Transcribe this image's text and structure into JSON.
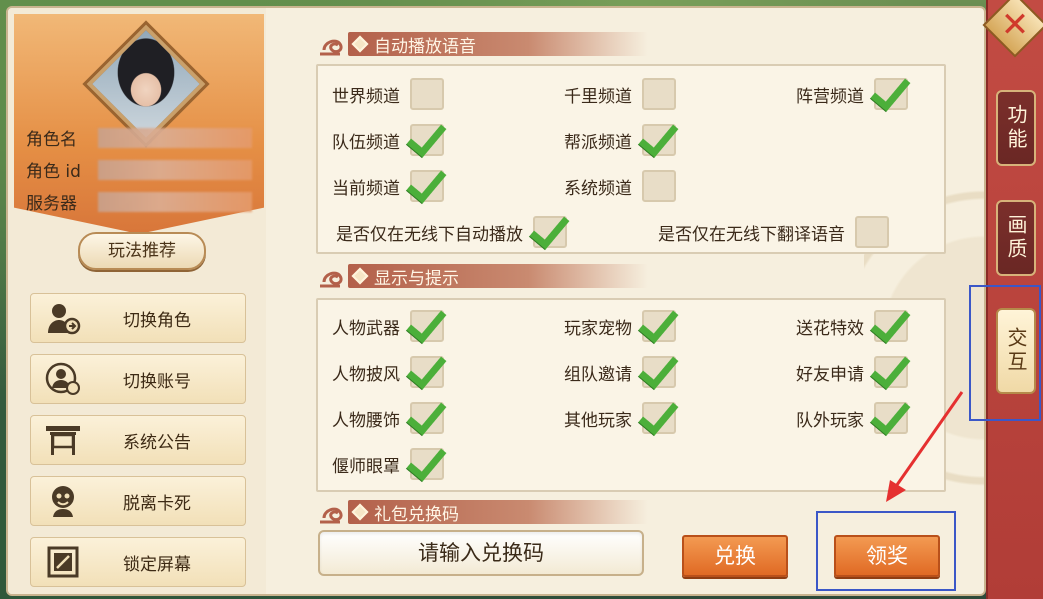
{
  "profile": {
    "name_label": "角色名",
    "id_label": "角色 id",
    "server_label": "服务器",
    "recommend_label": "玩法推荐"
  },
  "left_menu": {
    "items": [
      {
        "label": "切换角色",
        "icon": "switch-character-icon"
      },
      {
        "label": "切换账号",
        "icon": "switch-account-icon"
      },
      {
        "label": "系统公告",
        "icon": "announcement-icon"
      },
      {
        "label": "脱离卡死",
        "icon": "unstuck-icon"
      },
      {
        "label": "锁定屏幕",
        "icon": "lock-screen-icon"
      }
    ]
  },
  "sections": {
    "voice": {
      "title": "自动播放语音",
      "options": [
        {
          "label": "世界频道",
          "checked": false
        },
        {
          "label": "千里频道",
          "checked": false
        },
        {
          "label": "阵营频道",
          "checked": true
        },
        {
          "label": "队伍频道",
          "checked": true
        },
        {
          "label": "帮派频道",
          "checked": true
        },
        {
          "label": "当前频道",
          "checked": true
        },
        {
          "label": "系统频道",
          "checked": false
        },
        {
          "label": "是否仅在无线下自动播放",
          "checked": true
        },
        {
          "label": "是否仅在无线下翻译语音",
          "checked": false
        }
      ]
    },
    "display": {
      "title": "显示与提示",
      "options": [
        {
          "label": "人物武器",
          "checked": true
        },
        {
          "label": "玩家宠物",
          "checked": true
        },
        {
          "label": "送花特效",
          "checked": true
        },
        {
          "label": "人物披风",
          "checked": true
        },
        {
          "label": "组队邀请",
          "checked": true
        },
        {
          "label": "好友申请",
          "checked": true
        },
        {
          "label": "人物腰饰",
          "checked": true
        },
        {
          "label": "其他玩家",
          "checked": true
        },
        {
          "label": "队外玩家",
          "checked": true
        },
        {
          "label": "偃师眼罩",
          "checked": true
        }
      ]
    },
    "gift": {
      "title": "礼包兑换码",
      "input_placeholder": "请输入兑换码",
      "redeem_label": "兑换",
      "claim_label": "领奖"
    }
  },
  "tabs": [
    {
      "label": "功能",
      "active": false
    },
    {
      "label": "画质",
      "active": false
    },
    {
      "label": "交互",
      "active": true
    }
  ],
  "colors": {
    "accent_orange": "#e06a24",
    "tab_red": "#b13d37",
    "check_green": "#4caf3a",
    "highlight_blue": "#3b57c7",
    "arrow_red": "#e53030"
  }
}
